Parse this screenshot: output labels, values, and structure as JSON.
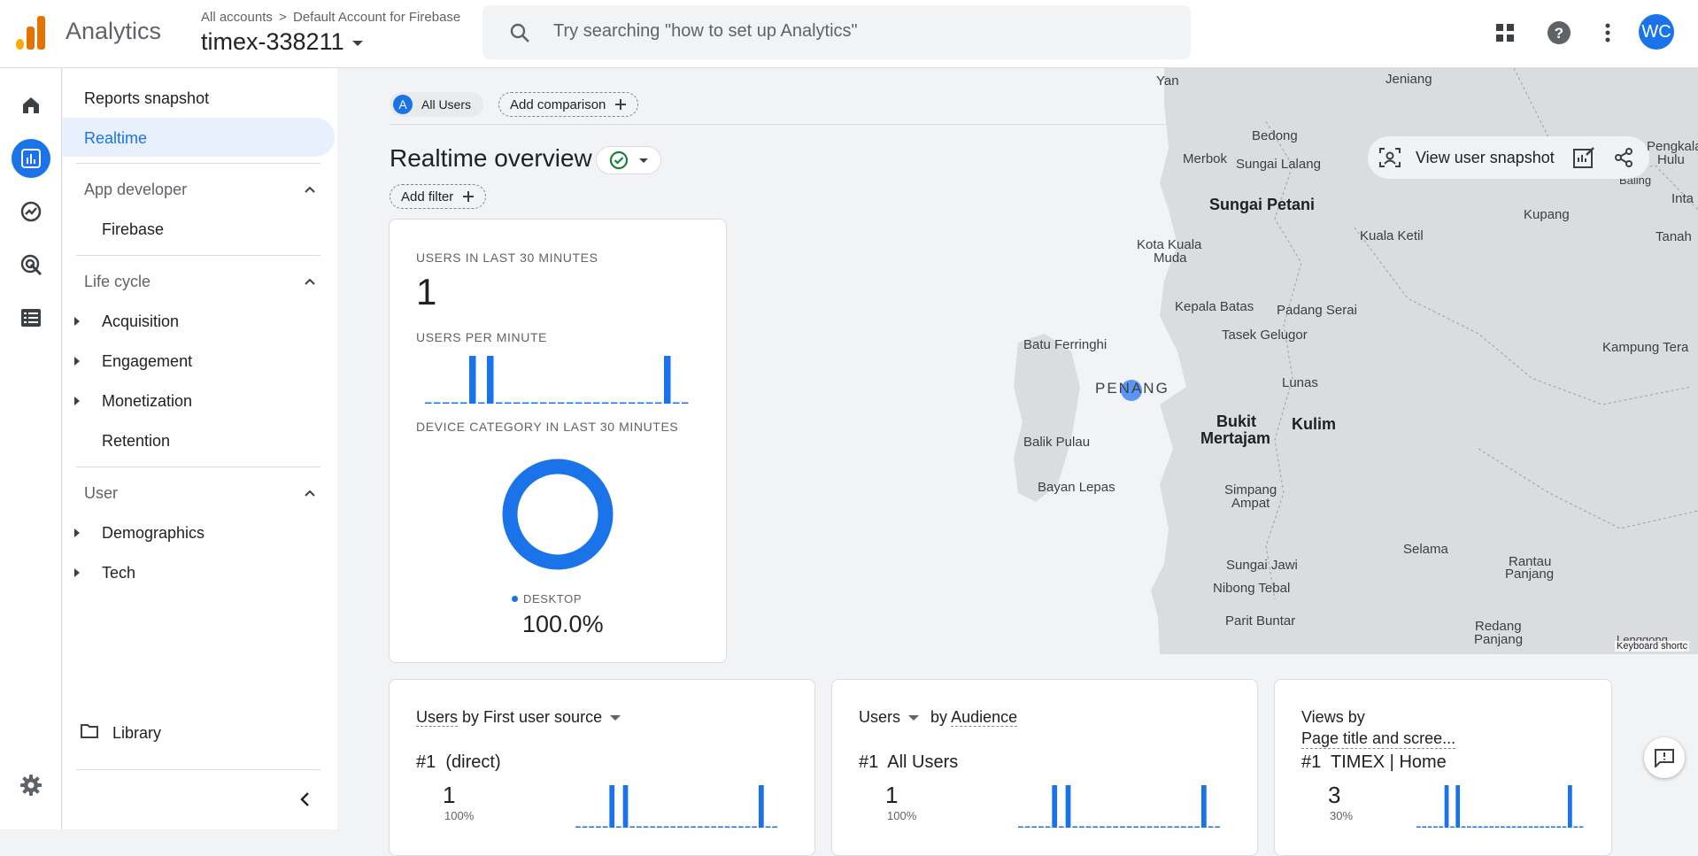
{
  "header": {
    "app_name": "Analytics",
    "breadcrumb_root": "All accounts",
    "breadcrumb_separator": ">",
    "breadcrumb_account": "Default Account for Firebase",
    "property": "timex-338211",
    "search_placeholder": "Try searching \"how to set up Analytics\"",
    "avatar_initials": "WC"
  },
  "nav": {
    "reports_snapshot": "Reports snapshot",
    "realtime": "Realtime",
    "app_developer": "App developer",
    "firebase": "Firebase",
    "life_cycle": "Life cycle",
    "acquisition": "Acquisition",
    "engagement": "Engagement",
    "monetization": "Monetization",
    "retention": "Retention",
    "user": "User",
    "demographics": "Demographics",
    "tech": "Tech",
    "library": "Library"
  },
  "toolbar": {
    "segment_badge": "A",
    "segment": "All Users",
    "add_comparison": "Add comparison",
    "add_filter": "Add filter",
    "page_title": "Realtime overview",
    "view_user_snapshot": "View user snapshot"
  },
  "summary_card": {
    "users_label": "USERS IN LAST 30 MINUTES",
    "users_value": "1",
    "per_minute_label": "USERS PER MINUTE",
    "per_minute_values": [
      0,
      0,
      0,
      0,
      0,
      1,
      0,
      1,
      0,
      0,
      0,
      0,
      0,
      0,
      0,
      0,
      0,
      0,
      0,
      0,
      0,
      0,
      0,
      0,
      0,
      0,
      0,
      1,
      0,
      0
    ],
    "device_label": "DEVICE CATEGORY IN LAST 30 MINUTES",
    "device_legend": "DESKTOP",
    "device_value": "100.0%",
    "accent": "#1a73e8"
  },
  "map": {
    "labels": [
      "Yan",
      "Jeniang",
      "Bedong",
      "Merbok",
      "Sungai Lalang",
      "Sungai Petani",
      "Kota Kuala",
      "Muda",
      "Kuala Ketil",
      "Kupang",
      "Kepala Batas",
      "Padang Serai",
      "Batu Ferringhi",
      "Tasek Gelugor",
      "PENANG",
      "Lunas",
      "Bukit",
      "Mertajam",
      "Kulim",
      "Balik Pulau",
      "Bayan Lepas",
      "Simpang",
      "Ampat",
      "Selama",
      "Rantau",
      "Panjang",
      "Sungai Jawi",
      "Nibong Tebal",
      "Parit Buntar",
      "Redang",
      "Panjang",
      "Kampung Tera",
      "Pengkala",
      "Hulu",
      "Baling",
      "Inta",
      "Tanah",
      "Lenggong"
    ],
    "keyboard": "Keyboard shortc"
  },
  "cards": [
    {
      "title_a": "Users",
      "title_b": "by First user source",
      "rank": "#1",
      "top_item": "(direct)",
      "value": "1",
      "pct": "100%"
    },
    {
      "title_a": "Users",
      "title_b": "by",
      "title_c": "Audience",
      "rank": "#1",
      "top_item": "All Users",
      "value": "1",
      "pct": "100%"
    },
    {
      "title_a": "Views by",
      "title_b": "Page title and scree...",
      "rank": "#1",
      "top_item": "TIMEX | Home",
      "value": "3",
      "pct": "30%"
    }
  ]
}
